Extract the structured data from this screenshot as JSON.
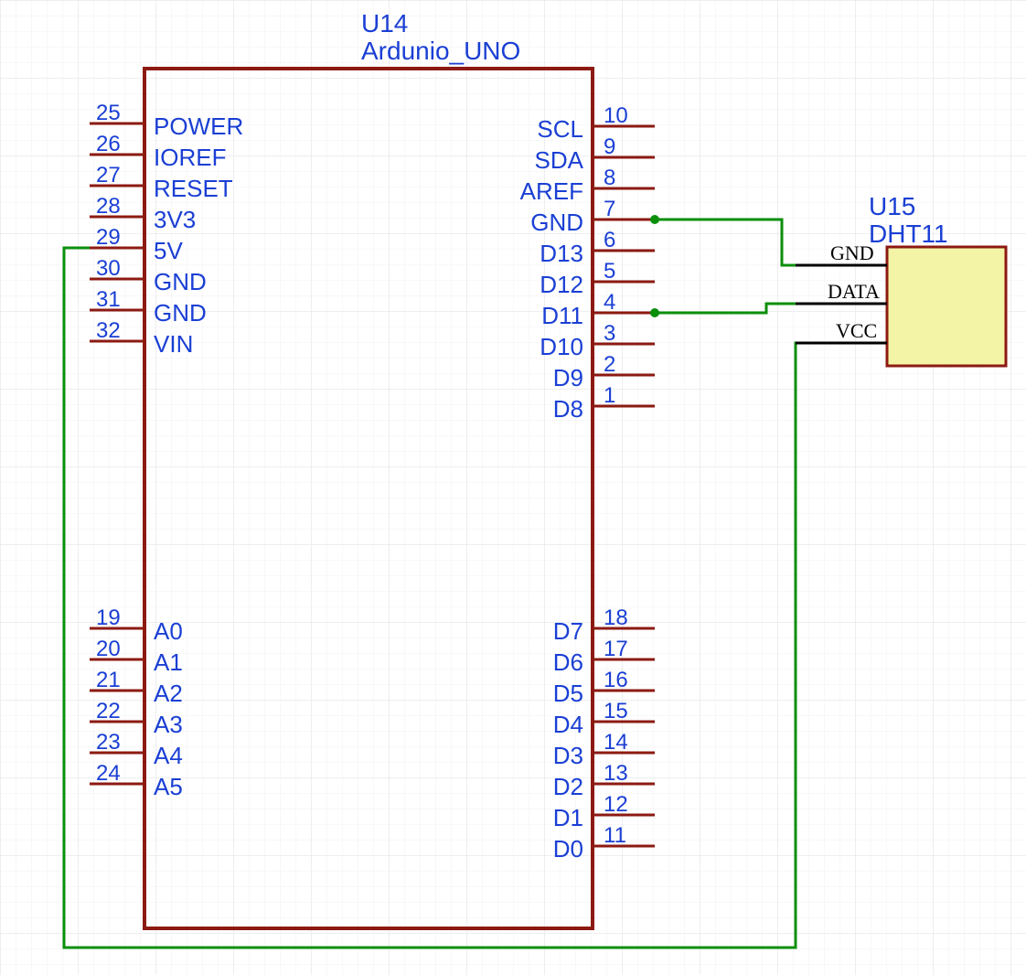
{
  "main_component": {
    "ref": "U14",
    "value": "Ardunio_UNO",
    "left_pins_top": [
      {
        "num": "25",
        "name": "POWER"
      },
      {
        "num": "26",
        "name": "IOREF"
      },
      {
        "num": "27",
        "name": "RESET"
      },
      {
        "num": "28",
        "name": "3V3"
      },
      {
        "num": "29",
        "name": "5V"
      },
      {
        "num": "30",
        "name": "GND"
      },
      {
        "num": "31",
        "name": "GND"
      },
      {
        "num": "32",
        "name": "VIN"
      }
    ],
    "left_pins_bottom": [
      {
        "num": "19",
        "name": "A0"
      },
      {
        "num": "20",
        "name": "A1"
      },
      {
        "num": "21",
        "name": "A2"
      },
      {
        "num": "22",
        "name": "A3"
      },
      {
        "num": "23",
        "name": "A4"
      },
      {
        "num": "24",
        "name": "A5"
      }
    ],
    "right_pins_top": [
      {
        "num": "10",
        "name": "SCL"
      },
      {
        "num": "9",
        "name": "SDA"
      },
      {
        "num": "8",
        "name": "AREF"
      },
      {
        "num": "7",
        "name": "GND"
      },
      {
        "num": "6",
        "name": "D13"
      },
      {
        "num": "5",
        "name": "D12"
      },
      {
        "num": "4",
        "name": "D11"
      },
      {
        "num": "3",
        "name": "D10"
      },
      {
        "num": "2",
        "name": "D9"
      },
      {
        "num": "1",
        "name": "D8"
      }
    ],
    "right_pins_bottom": [
      {
        "num": "18",
        "name": "D7"
      },
      {
        "num": "17",
        "name": "D6"
      },
      {
        "num": "16",
        "name": "D5"
      },
      {
        "num": "15",
        "name": "D4"
      },
      {
        "num": "14",
        "name": "D3"
      },
      {
        "num": "13",
        "name": "D2"
      },
      {
        "num": "12",
        "name": "D1"
      },
      {
        "num": "11",
        "name": "D0"
      }
    ]
  },
  "sensor": {
    "ref": "U15",
    "value": "DHT11",
    "pins": [
      "GND",
      "DATA",
      "VCC"
    ]
  },
  "colors": {
    "grid_major": "#e8e8ee",
    "grid_minor": "#f1f1f5",
    "component_outline": "#8c1a12",
    "pin_line": "#8c1a12",
    "text": "#1a3fd4",
    "wire": "#0b8f0b",
    "sensor_fill": "#f4f4a7",
    "black": "#000"
  }
}
